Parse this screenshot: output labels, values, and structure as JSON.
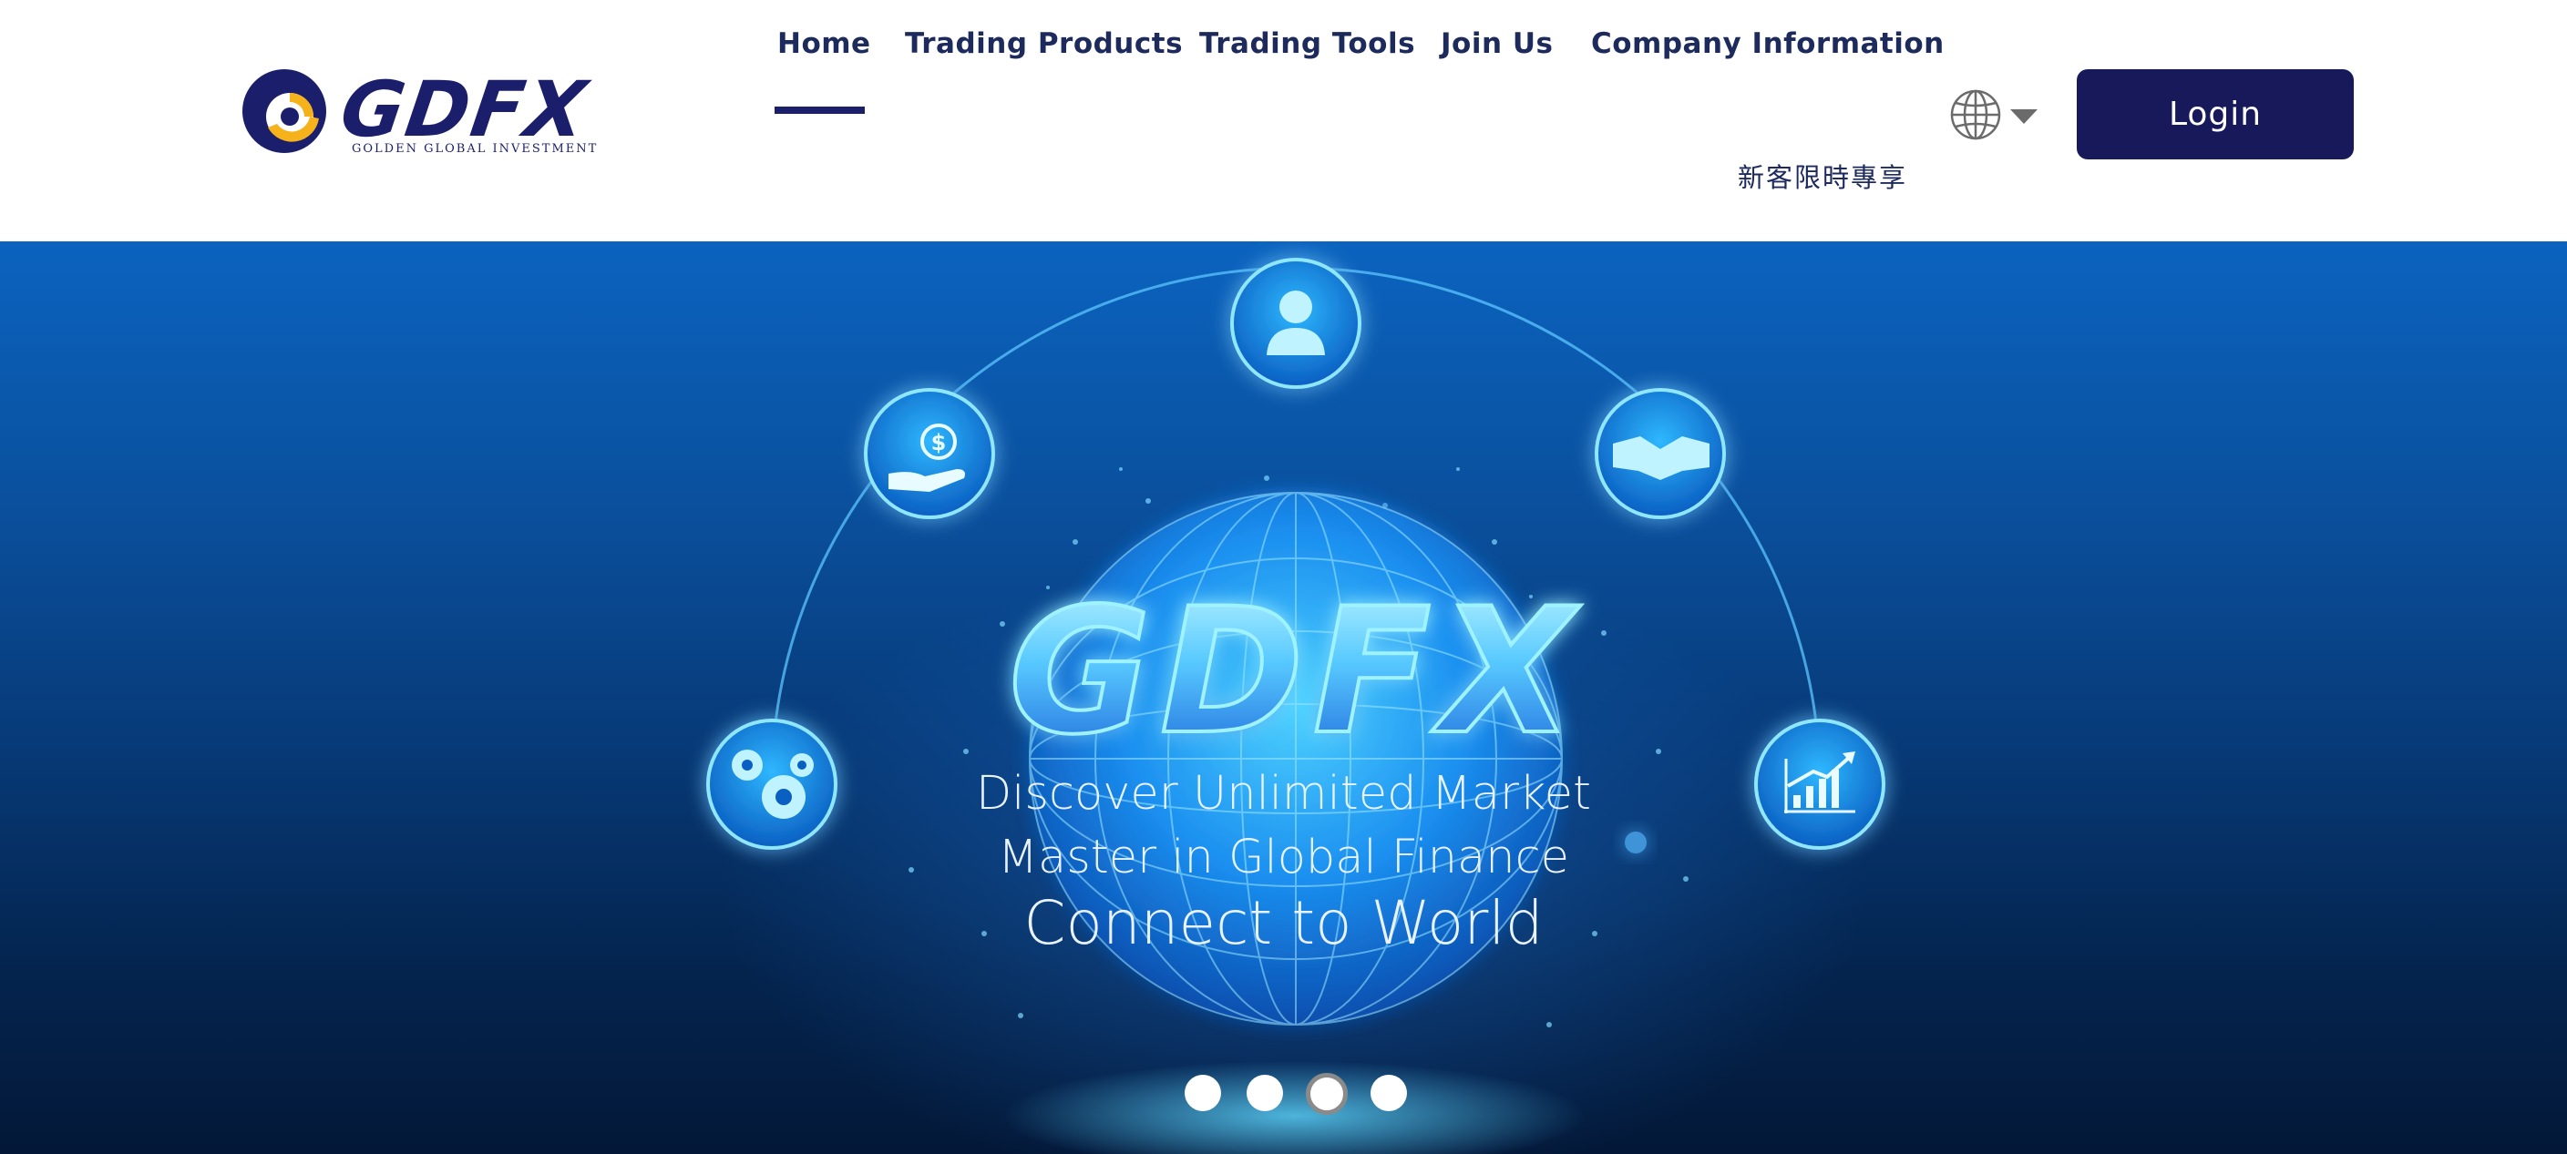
{
  "header": {
    "logo": {
      "wordmark": "GDFX",
      "subtitle": "GOLDEN GLOBAL INVESTMENT"
    },
    "nav": [
      {
        "label": "Home",
        "active": true
      },
      {
        "label": "Trading Products"
      },
      {
        "label": "Trading Tools"
      },
      {
        "label": "Join Us"
      },
      {
        "label": "Company Information"
      }
    ],
    "promo_link": "新客限時專享",
    "language_icon": "globe-icon",
    "login_label": "Login"
  },
  "hero": {
    "logo_text": "GDFX",
    "taglines": [
      "Discover Unlimited Market",
      "Master in Global Finance",
      "Connect to World"
    ],
    "orbit_icons": [
      "gears-icon",
      "money-hand-icon",
      "user-icon",
      "handshake-icon",
      "growth-chart-icon"
    ],
    "carousel": {
      "total": 4,
      "active_index": 2
    }
  },
  "colors": {
    "brand_navy": "#1b1f6b",
    "login_bg": "#17195b",
    "hero_top": "#0b63bf",
    "hero_bottom": "#031838",
    "logo_gold": "#f5b21b",
    "glow_cyan": "#5fe0ff"
  }
}
